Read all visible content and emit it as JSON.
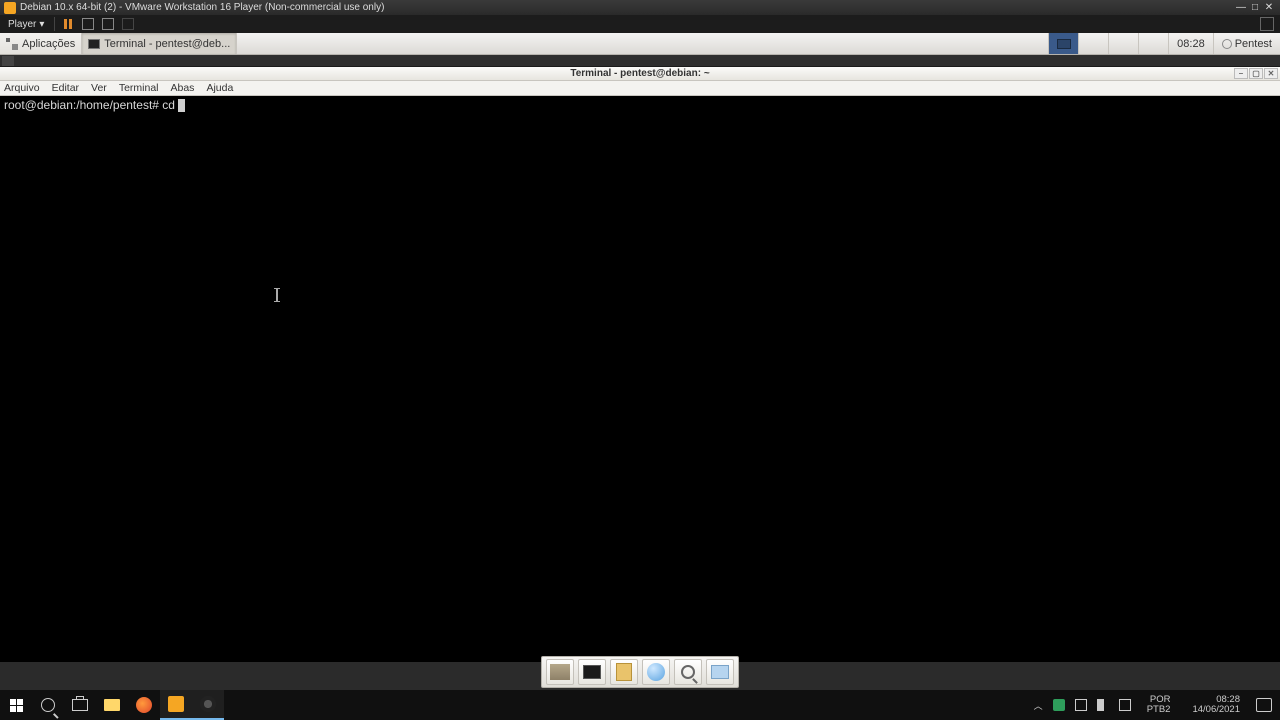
{
  "vmware": {
    "title": "Debian 10.x 64-bit (2) - VMware Workstation 16 Player (Non-commercial use only)",
    "player_menu": "Player",
    "window_controls": {
      "min": "—",
      "max": "□",
      "close": "✕"
    }
  },
  "guest_panel": {
    "apps_label": "Aplicações",
    "task_label": "Terminal - pentest@deb...",
    "clock": "08:28",
    "user": "Pentest"
  },
  "terminal": {
    "title": "Terminal - pentest@debian: ~",
    "menus": [
      "Arquivo",
      "Editar",
      "Ver",
      "Terminal",
      "Abas",
      "Ajuda"
    ],
    "prompt": "root@debian:/home/pentest#",
    "command": "cd",
    "window_controls": {
      "min": "–",
      "max": "▢",
      "close": "✕"
    }
  },
  "win_tray": {
    "lang1": "POR",
    "lang2": "PTB2",
    "time": "08:28",
    "date": "14/06/2021"
  }
}
